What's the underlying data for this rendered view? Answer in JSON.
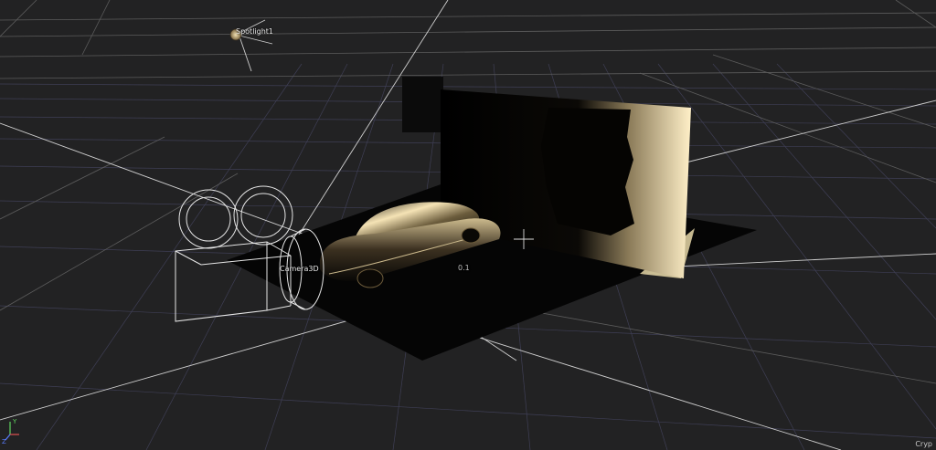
{
  "viewport": {
    "spotlight_label": "Spotlight1",
    "camera_label": "Camera3D",
    "distance_label": "0.1",
    "corner_label": "Cryp",
    "axis_labels": [
      "Y",
      "Z"
    ],
    "colors": {
      "background": "#222223",
      "grid_major": "#6a6a6a",
      "grid_minor": "#4a4a68",
      "wireframe": "#e8e8e8",
      "light_warm": "#f3e5bf"
    }
  }
}
